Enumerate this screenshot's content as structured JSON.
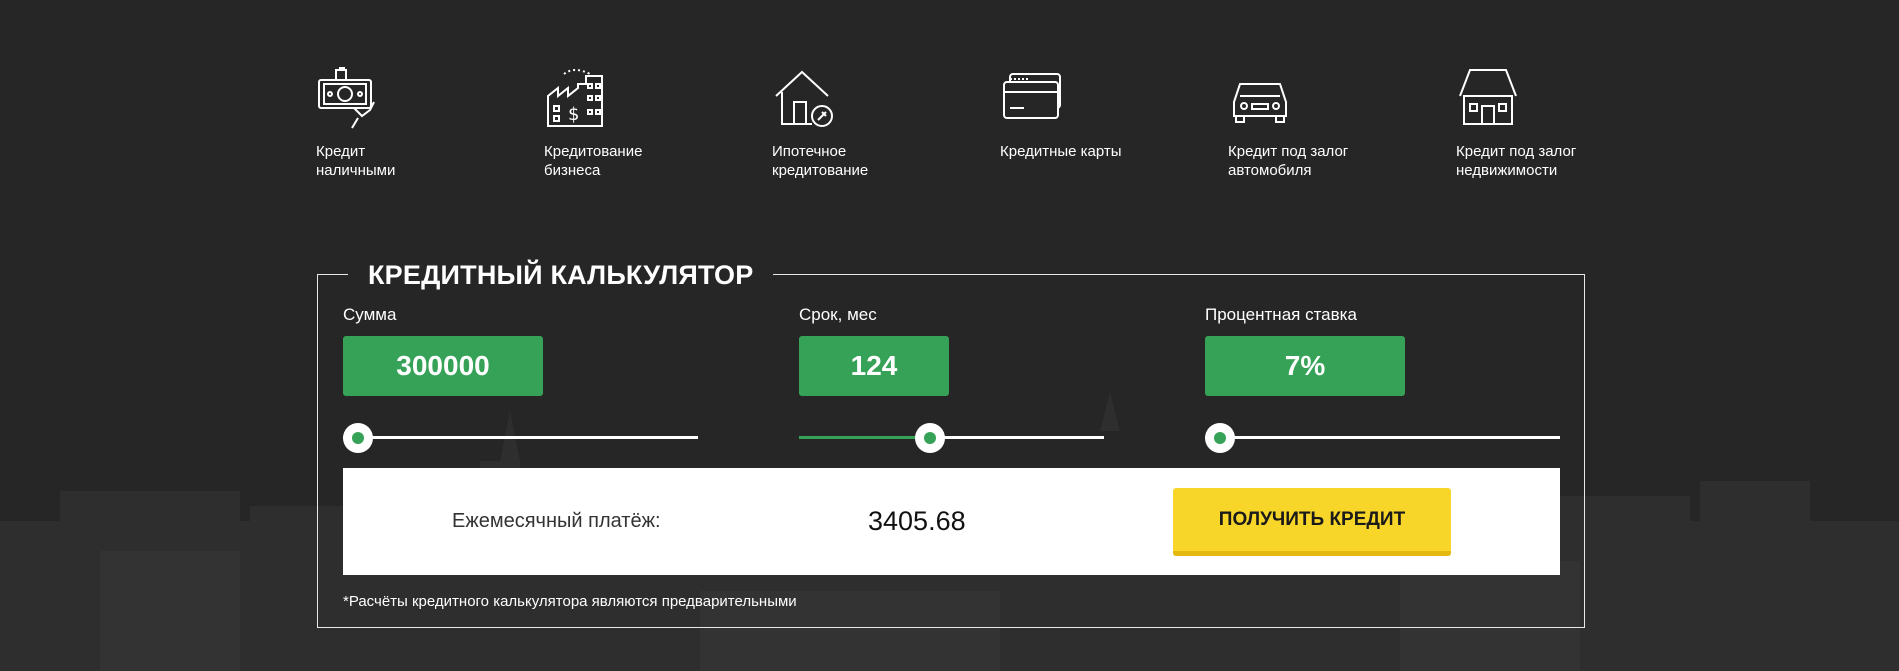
{
  "colors": {
    "background": "#262626",
    "accent_green": "#36a257",
    "button_yellow": "#f7d629",
    "border": "#e8e8e8"
  },
  "categories": [
    {
      "label": "Кредит\nналичными",
      "icon": "cash-hand-icon"
    },
    {
      "label": "Кредитование\nбизнеса",
      "icon": "business-building-icon"
    },
    {
      "label": "Ипотечное\nкредитование",
      "icon": "house-key-icon"
    },
    {
      "label": "Кредитные карты",
      "icon": "credit-cards-icon"
    },
    {
      "label": "Кредит под залог\nавтомобиля",
      "icon": "car-icon"
    },
    {
      "label": "Кредит под залог\nнедвижимости",
      "icon": "house-icon"
    }
  ],
  "calculator": {
    "title": "КРЕДИТНЫЙ КАЛЬКУЛЯТОР",
    "fields": [
      {
        "label": "Сумма",
        "value": "300000",
        "slider_fraction": 0.0
      },
      {
        "label": "Срок, мес",
        "value": "124",
        "slider_fraction": 0.42
      },
      {
        "label": "Процентная ставка",
        "value": "7%",
        "slider_fraction": 0.0
      }
    ],
    "result_label": "Ежемесячный платёж:",
    "result_value": "3405.68",
    "button_label": "ПОЛУЧИТЬ КРЕДИТ",
    "note": "*Расчёты кредитного калькулятора являются предварительными"
  }
}
